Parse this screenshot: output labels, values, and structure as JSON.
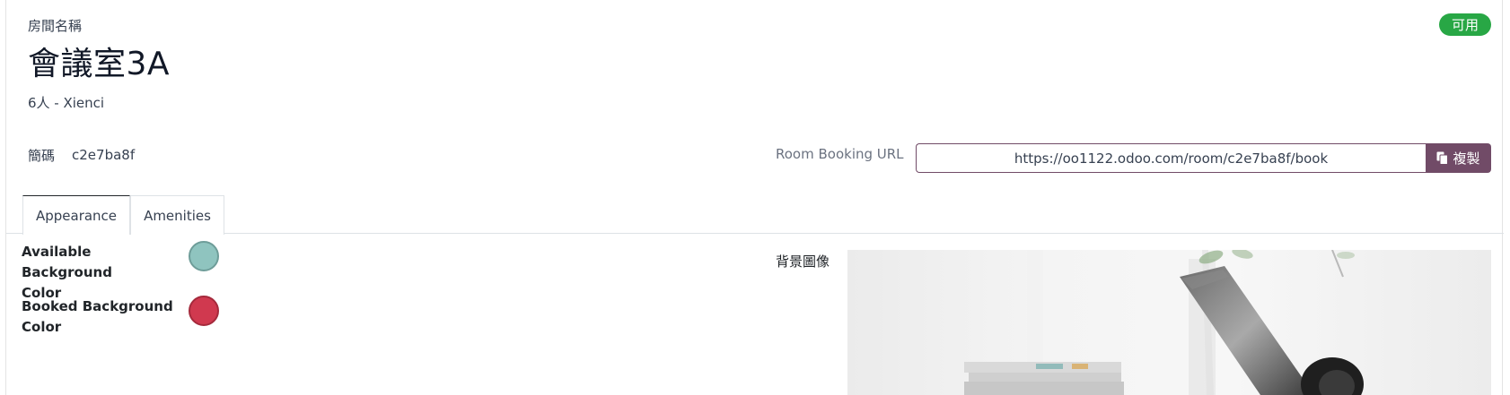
{
  "header": {
    "room_label": "房間名稱",
    "room_name": "會議室3A",
    "subtitle": "6人 - Xienci",
    "status": "可用",
    "status_color": "#28a745"
  },
  "code": {
    "label": "簡碼",
    "value": "c2e7ba8f"
  },
  "booking_url": {
    "label": "Room Booking URL",
    "value": "https://oo1122.odoo.com/room/c2e7ba8f/book",
    "copy_label": "複製",
    "accent_color": "#714b67"
  },
  "tabs": [
    {
      "label": "Appearance",
      "active": true
    },
    {
      "label": "Amenities",
      "active": false
    }
  ],
  "appearance": {
    "available_label_line1": "Available Background",
    "available_label_line2": "Color",
    "available_color": "#8fc4bf",
    "booked_label_line1": "Booked Background",
    "booked_label_line2": "Color",
    "booked_color": "#d0394f",
    "background_image_label": "背景圖像"
  }
}
